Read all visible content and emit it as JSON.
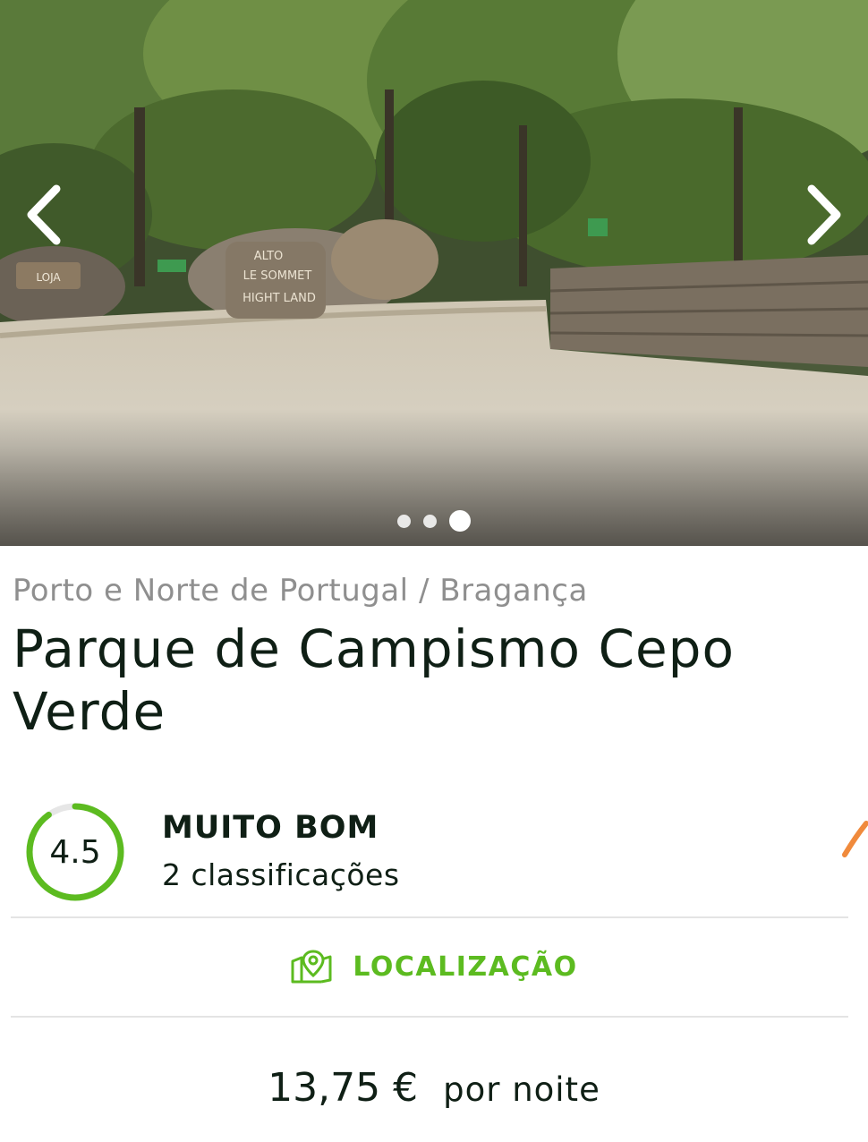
{
  "carousel": {
    "image_alt": "Campsite entrance with dirt road and stone wall",
    "slide_count": 3,
    "active_slide": 3,
    "sign_text": [
      "LOJA",
      "ALTO",
      "LE SOMMET",
      "HIGHT LAND"
    ]
  },
  "location": {
    "breadcrumb": "Porto e Norte de Portugal / Bragança"
  },
  "campsite": {
    "name": "Parque de Campismo Cepo Verde"
  },
  "rating": {
    "value": "4.5",
    "max": 5,
    "label": "MUITO BOM",
    "count_text": "2 classificações",
    "color": "#5cbb20"
  },
  "actions": {
    "location_label": "LOCALIZAÇÃO"
  },
  "price": {
    "amount": "13,75 €",
    "unit": "por noite"
  },
  "colors": {
    "accent_green": "#5cbb20",
    "text_dark": "#0f1f15",
    "breadcrumb_grey": "#8f8f8f",
    "edge_orange": "#f08a3c"
  }
}
